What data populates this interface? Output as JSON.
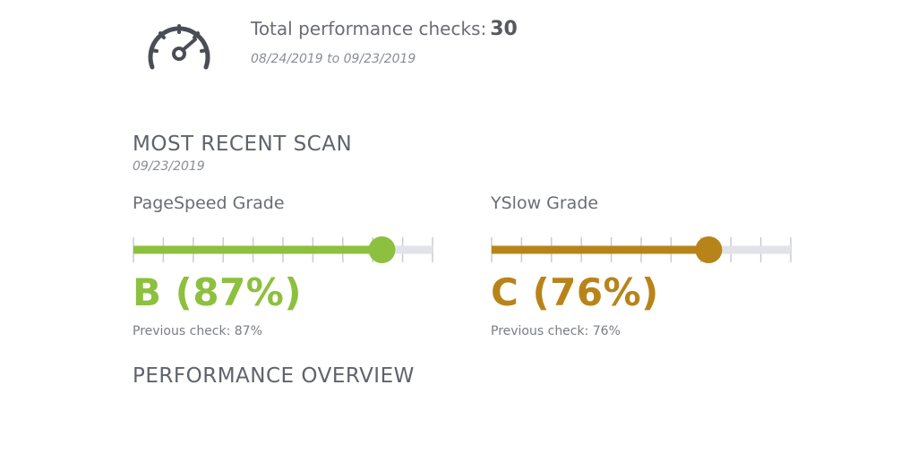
{
  "header": {
    "icon": "speedometer-icon",
    "total_checks_label": "Total performance checks:",
    "total_checks_value": "30",
    "date_range": "08/24/2019 to 09/23/2019"
  },
  "recent_scan": {
    "title": "MOST RECENT SCAN",
    "date": "09/23/2019"
  },
  "grades": {
    "pagespeed": {
      "label": "PageSpeed Grade",
      "value_text": "B (87%)",
      "score": 87,
      "previous": "Previous check: 87%",
      "color": "#8dc03f"
    },
    "yslow": {
      "label": "YSlow Grade",
      "value_text": "C (76%)",
      "score": 76,
      "previous": "Previous check: 76%",
      "color": "#b88419"
    }
  },
  "overview": {
    "title": "PERFORMANCE OVERVIEW"
  },
  "colors": {
    "track": "#e2e3e8",
    "tick": "#c9cbd0",
    "text": "#5f636b",
    "icon": "#4a4d54"
  }
}
